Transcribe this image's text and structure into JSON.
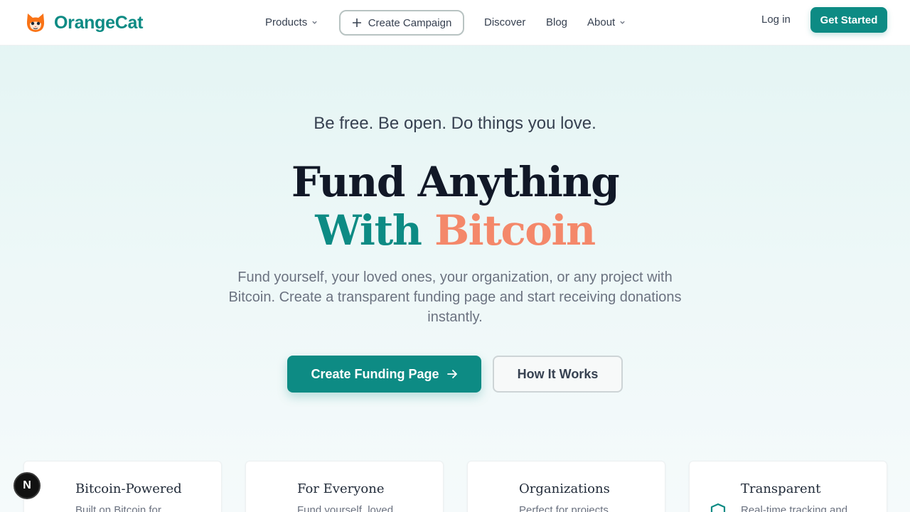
{
  "header": {
    "brand": "OrangeCat",
    "nav": {
      "products": "Products",
      "create_campaign": "Create Campaign",
      "discover": "Discover",
      "blog": "Blog",
      "about": "About"
    },
    "login": "Log in",
    "get_started": "Get Started"
  },
  "hero": {
    "tagline": "Be free. Be open. Do things you love.",
    "headline_line1": "Fund Anything",
    "headline_with": "With",
    "headline_bitcoin": "Bitcoin",
    "subtext": "Fund yourself, your loved ones, your organization, or any project with Bitcoin. Create a transparent funding page and start receiving donations instantly.",
    "primary_cta": "Create Funding Page",
    "secondary_cta": "How It Works"
  },
  "features": [
    {
      "title": "Bitcoin-Powered",
      "text": "Built on Bitcoin for"
    },
    {
      "title": "For Everyone",
      "text": "Fund yourself, loved"
    },
    {
      "title": "Organizations",
      "text": "Perfect for projects"
    },
    {
      "title": "Transparent",
      "text": "Real-time tracking and"
    }
  ],
  "dev_badge": "N",
  "colors": {
    "brand_teal": "#0d8b84",
    "accent_orange": "#f4886a",
    "logo_orange": "#f97316"
  }
}
